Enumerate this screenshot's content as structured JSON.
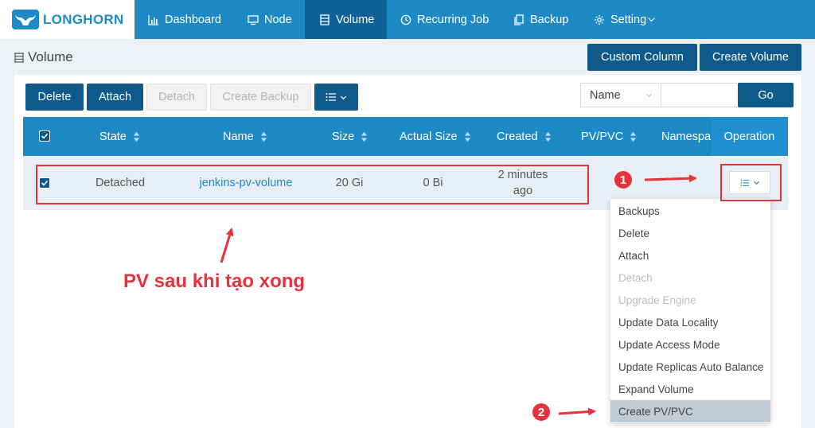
{
  "brand": {
    "name": "LONGHORN"
  },
  "nav": {
    "items": [
      {
        "label": "Dashboard",
        "icon": "bar-chart-icon"
      },
      {
        "label": "Node",
        "icon": "monitor-icon"
      },
      {
        "label": "Volume",
        "icon": "database-icon",
        "active": true
      },
      {
        "label": "Recurring Job",
        "icon": "clock-icon"
      },
      {
        "label": "Backup",
        "icon": "copy-icon"
      },
      {
        "label": "Setting",
        "icon": "gear-icon"
      }
    ]
  },
  "page": {
    "title": "Volume"
  },
  "header_buttons": {
    "custom_column": "Custom Column",
    "create_volume": "Create Volume"
  },
  "toolbar": {
    "delete": "Delete",
    "attach": "Attach",
    "detach": "Detach",
    "create_backup": "Create Backup",
    "search_field": "Name",
    "go": "Go"
  },
  "table": {
    "columns": {
      "state": "State",
      "name": "Name",
      "size": "Size",
      "actual_size": "Actual Size",
      "created": "Created",
      "pv_pvc": "PV/PVC",
      "namespace": "Namespace",
      "operation": "Operation"
    },
    "rows": [
      {
        "checked": true,
        "state": "Detached",
        "name": "jenkins-pv-volume",
        "size": "20 Gi",
        "actual_size": "0 Bi",
        "created_line1": "2 minutes",
        "created_line2": "ago"
      }
    ]
  },
  "operation_menu": {
    "items": [
      {
        "label": "Backups",
        "disabled": false
      },
      {
        "label": "Delete",
        "disabled": false
      },
      {
        "label": "Attach",
        "disabled": false
      },
      {
        "label": "Detach",
        "disabled": true
      },
      {
        "label": "Upgrade Engine",
        "disabled": true
      },
      {
        "label": "Update Data Locality",
        "disabled": false
      },
      {
        "label": "Update Access Mode",
        "disabled": false
      },
      {
        "label": "Update Replicas Auto Balance",
        "disabled": false
      },
      {
        "label": "Expand Volume",
        "disabled": false
      },
      {
        "label": "Create PV/PVC",
        "disabled": false,
        "hovered": true
      }
    ]
  },
  "annotations": {
    "caption": "PV sau khi tạo xong",
    "step1": "1",
    "step2": "2",
    "color": "#e5333b"
  },
  "colors": {
    "nav_bg": "#1d8ac6",
    "nav_active": "#0f6297",
    "button_primary": "#0e5a8a",
    "row_bg": "#e7eef4"
  }
}
